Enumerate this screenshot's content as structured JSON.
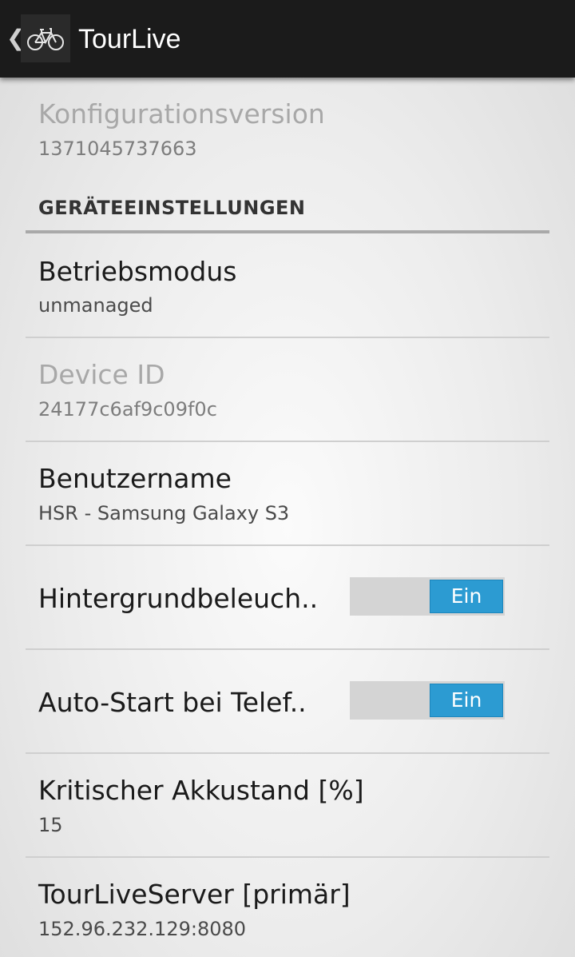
{
  "action_bar": {
    "title": "TourLive",
    "up_glyph": "❮",
    "app_icon": "bicycle-icon"
  },
  "prefs": {
    "config_version": {
      "title": "Konfigurationsversion",
      "summary": "1371045737663",
      "enabled": false
    },
    "category_label": "GERÄTEEINSTELLUNGEN",
    "betriebsmodus": {
      "title": "Betriebsmodus",
      "summary": "unmanaged"
    },
    "device_id": {
      "title": "Device ID",
      "summary": "24177c6af9c09f0c",
      "enabled": false
    },
    "benutzername": {
      "title": "Benutzername",
      "summary": "HSR - Samsung Galaxy S3"
    },
    "hintergrund": {
      "title": "Hintergrundbeleuch..",
      "switch_label": "Ein",
      "checked": true
    },
    "autostart": {
      "title": "Auto-Start bei Telef..",
      "switch_label": "Ein",
      "checked": true
    },
    "akkustand": {
      "title": "Kritischer Akkustand [%]",
      "summary": "15"
    },
    "server": {
      "title": "TourLiveServer [primär]",
      "summary": "152.96.232.129:8080"
    }
  },
  "colors": {
    "action_bar": "#1b1b1b",
    "switch_on": "#2c9bd2",
    "switch_track": "#d4d4d4",
    "category_rule": "#a9a9a9"
  }
}
